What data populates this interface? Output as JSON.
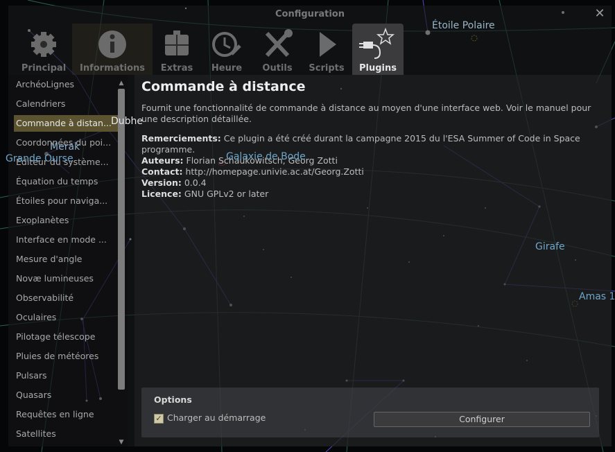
{
  "window": {
    "title": "Configuration"
  },
  "tabs": [
    {
      "label": "Principal",
      "icon": "gear-icon"
    },
    {
      "label": "Informations",
      "icon": "info-icon"
    },
    {
      "label": "Extras",
      "icon": "extras-gear-icon"
    },
    {
      "label": "Heure",
      "icon": "clock-wrench-icon"
    },
    {
      "label": "Outils",
      "icon": "tools-icon"
    },
    {
      "label": "Scripts",
      "icon": "play-icon"
    },
    {
      "label": "Plugins",
      "icon": "plug-star-icon"
    }
  ],
  "sidebar": {
    "items": [
      {
        "label": "ArchéoLignes"
      },
      {
        "label": "Calendriers"
      },
      {
        "label": "Commande à distan..."
      },
      {
        "label": "Coordonnées du poi..."
      },
      {
        "label": "Éditeur du système..."
      },
      {
        "label": "Équation du temps"
      },
      {
        "label": "Étoiles pour naviga..."
      },
      {
        "label": "Exoplanètes"
      },
      {
        "label": "Interface en mode ..."
      },
      {
        "label": "Mesure d'angle"
      },
      {
        "label": "Novæ lumineuses"
      },
      {
        "label": "Observabilité"
      },
      {
        "label": "Oculaires"
      },
      {
        "label": "Pilotage télescope"
      },
      {
        "label": "Pluies de météores"
      },
      {
        "label": "Pulsars"
      },
      {
        "label": "Quasars"
      },
      {
        "label": "Requêtes en ligne"
      },
      {
        "label": "Satellites"
      }
    ]
  },
  "plugin": {
    "title": "Commande à distance",
    "description": "Fournit une fonctionnalité de commande à distance au moyen d'une interface web. Voir le manuel pour une description détaillée.",
    "thanks_label": "Remerciements:",
    "thanks_text": "Ce plugin a été créé durant la campagne 2015 du l'ESA Summer of Code in Space programme.",
    "authors_label": "Auteurs:",
    "authors_text": "Florian Schaukowitsch, Georg Zotti",
    "contact_label": "Contact:",
    "contact_text": "http://homepage.univie.ac.at/Georg.Zotti",
    "version_label": "Version:",
    "version_text": "0.0.4",
    "license_label": "Licence:",
    "license_text": "GNU GPLv2 or later"
  },
  "options": {
    "title": "Options",
    "load_at_startup_label": "Charger au démarrage",
    "load_at_startup_checked": true,
    "configure_label": "Configurer"
  },
  "sky_labels": {
    "polaris": "Étoile Polaire",
    "dubhe": "Dubhe",
    "merak": "Merak",
    "ursa_major": "Grande Ourse",
    "bode": "Galaxie de Bode",
    "camelopardalis": "Girafe",
    "cluster": "Amas 1"
  },
  "colors": {
    "selected_bg": "#5b5330",
    "sky_label": "#6fa7c9",
    "constellation_line": "#4a4ab0",
    "grid_line": "#2f6e5c"
  }
}
